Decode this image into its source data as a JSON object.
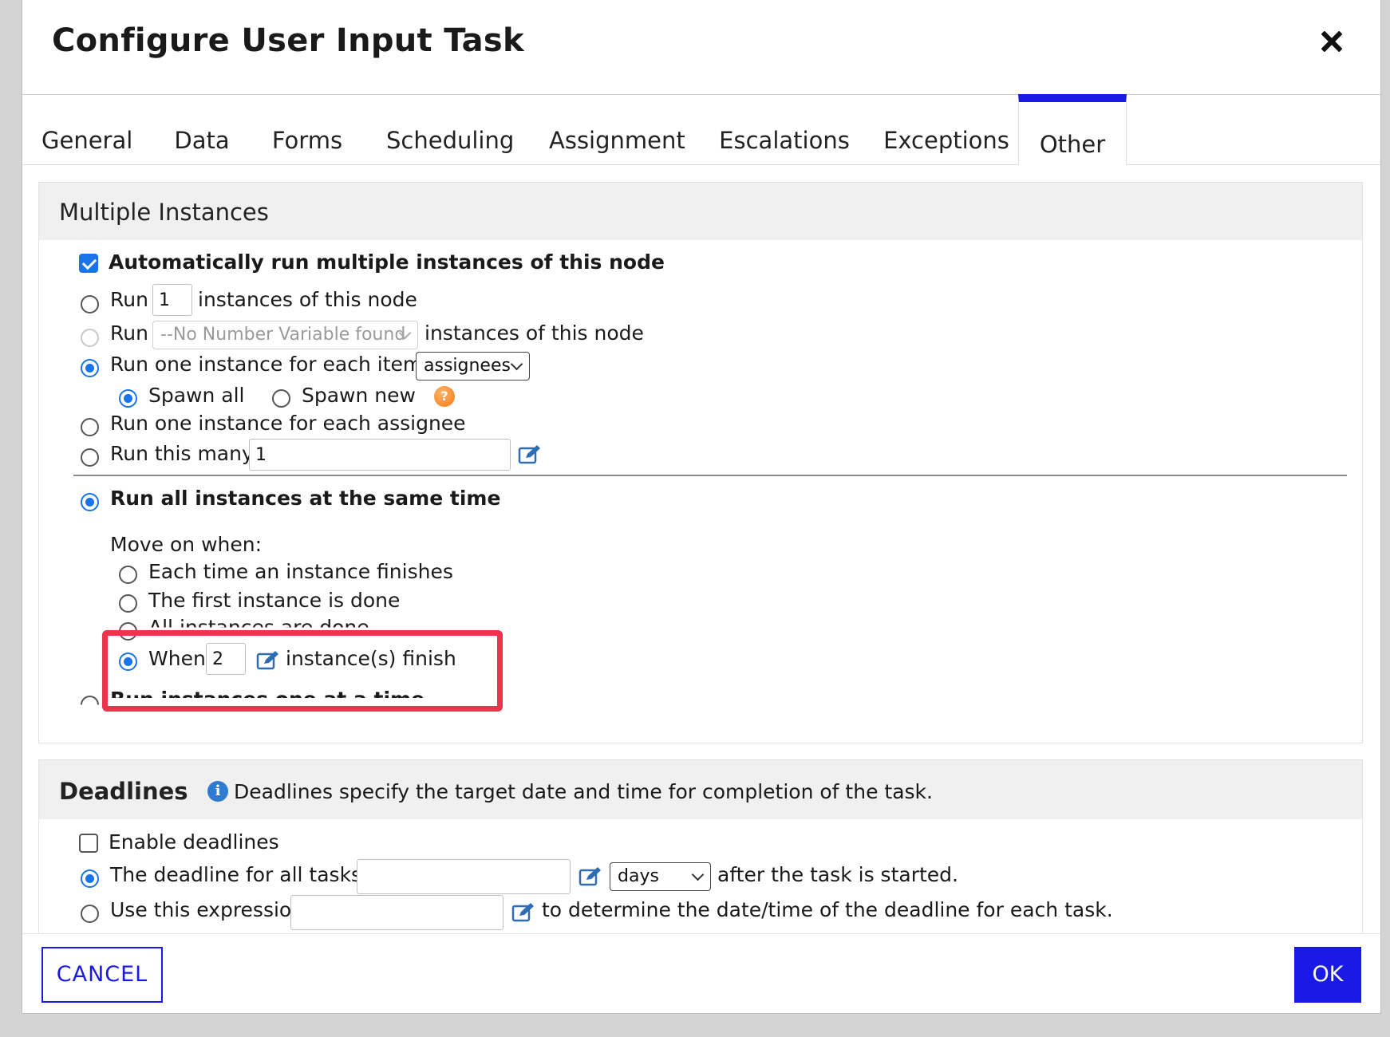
{
  "dialog": {
    "title": "Configure User Input Task"
  },
  "tabs": [
    {
      "label": "General"
    },
    {
      "label": "Data"
    },
    {
      "label": "Forms"
    },
    {
      "label": "Scheduling"
    },
    {
      "label": "Assignment"
    },
    {
      "label": "Escalations"
    },
    {
      "label": "Exceptions"
    },
    {
      "label": "Other",
      "active": true
    }
  ],
  "multiple_instances": {
    "title": "Multiple Instances",
    "auto_run_label": "Automatically run multiple instances of this node",
    "auto_run_checked": true,
    "run_fixed": {
      "prefix": "Run",
      "value": "1",
      "suffix": "instances of this node"
    },
    "run_variable": {
      "prefix": "Run",
      "select_value": "--No Number Variable found",
      "suffix": "instances of this node"
    },
    "run_each_item": {
      "label": "Run one instance for each item in",
      "select_value": "assignees",
      "selected": true
    },
    "spawn_all": "Spawn all",
    "spawn_new": "Spawn new",
    "run_each_assignee": "Run one instance for each assignee",
    "run_this_many": {
      "label": "Run this many:",
      "value": "1"
    },
    "run_same_time": "Run all instances at the same time",
    "move_on_when": "Move on when:",
    "move_options": {
      "each_finishes": "Each time an instance finishes",
      "first_done": "The first instance is done",
      "all_done": "All instances are done",
      "when_prefix": "When",
      "when_value": "2",
      "when_suffix": "instance(s) finish"
    },
    "run_one_at_time": "Run instances one at a time"
  },
  "deadlines": {
    "title": "Deadlines",
    "info_text": "Deadlines specify the target date and time for completion of the task.",
    "enable_label": "Enable deadlines",
    "enable_checked": false,
    "deadline_all": {
      "label": "The deadline for all tasks is",
      "value": "",
      "unit": "days",
      "suffix": "after the task is started."
    },
    "use_expression": {
      "label": "Use this expression",
      "value": "",
      "suffix": "to determine the date/time of the deadline for each task."
    }
  },
  "footer": {
    "cancel_label": "CANCEL",
    "ok_label": "OK"
  },
  "colors": {
    "accent": "#1a1ae6",
    "radio_selected": "#1a73e8",
    "highlight": "#f0334d"
  }
}
